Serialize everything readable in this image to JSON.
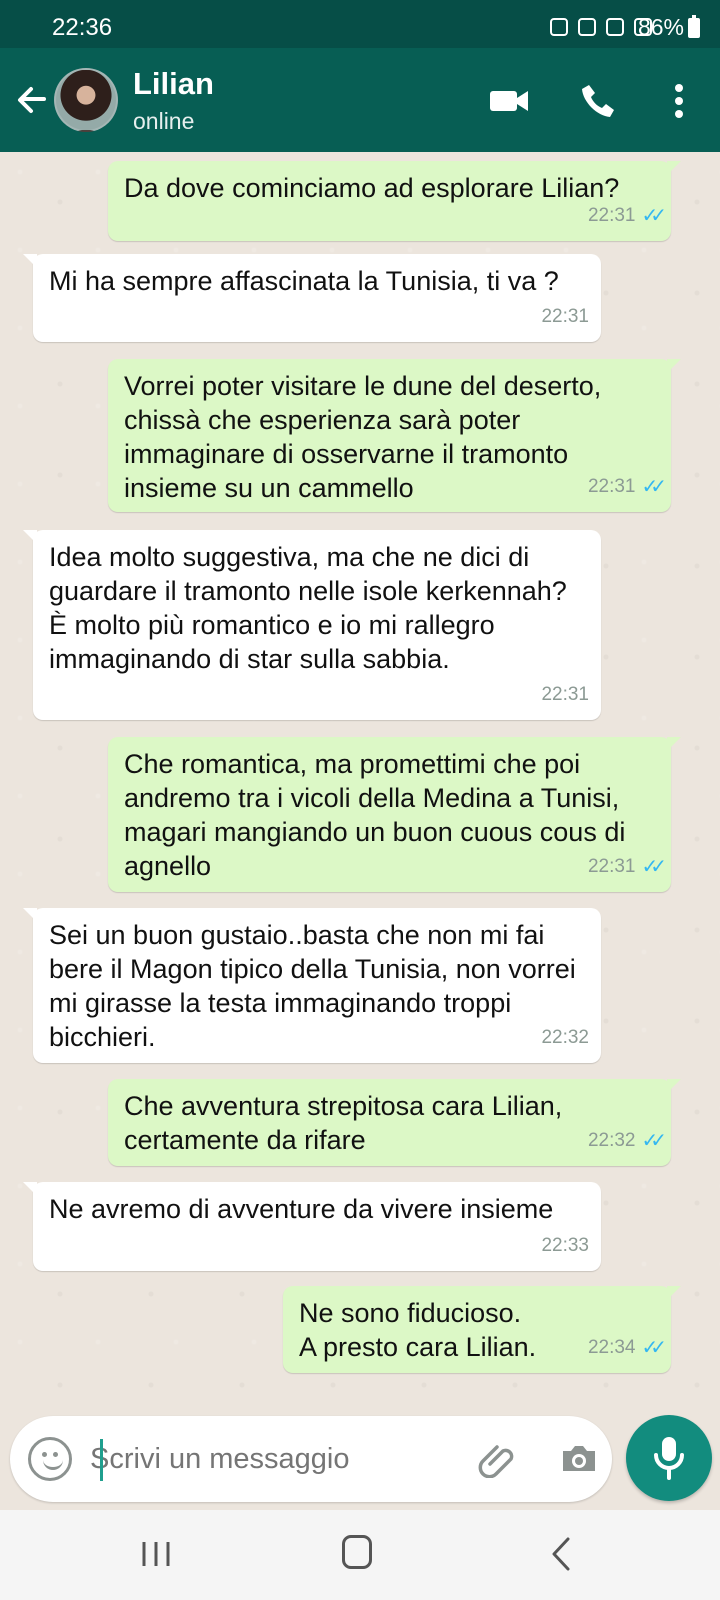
{
  "status_bar": {
    "time": "22:36",
    "battery": "86%"
  },
  "chat_header": {
    "contact_name": "Lilian",
    "status": "online",
    "icons": [
      "back-arrow-icon",
      "video-call-icon",
      "phone-icon",
      "more-options-icon"
    ]
  },
  "messages": [
    {
      "direction": "sent",
      "text": "Da dove cominciamo ad esplorare Lilian?",
      "time": "22:31",
      "read": true
    },
    {
      "direction": "received",
      "text": "Mi ha sempre affascinata la Tunisia, ti va ?",
      "time": "22:31"
    },
    {
      "direction": "sent",
      "text": "Vorrei poter visitare le dune del deserto, chissà che esperienza sarà poter immaginare di osservarne il tramonto insieme su un cammello",
      "time": "22:31",
      "read": true
    },
    {
      "direction": "received",
      "text": "Idea molto suggestiva, ma che ne dici di guardare il tramonto nelle isole kerkennah? È molto più romantico e io mi rallegro immaginando di star sulla sabbia.",
      "time": "22:31"
    },
    {
      "direction": "sent",
      "text": "Che romantica, ma promettimi che poi andremo tra i vicoli della Medina a Tunisi, magari mangiando un buon cuous cous di agnello",
      "time": "22:31",
      "read": true
    },
    {
      "direction": "received",
      "text": "Sei un buon gustaio..basta che non mi fai bere il Magon tipico della Tunisia, non vorrei mi girasse la testa immaginando troppi bicchieri.",
      "time": "22:32"
    },
    {
      "direction": "sent",
      "text": "Che avventura strepitosa cara Lilian, certamente da rifare",
      "time": "22:32",
      "read": true
    },
    {
      "direction": "received",
      "text": "Ne avremo di avventure da vivere insieme",
      "time": "22:33"
    },
    {
      "direction": "sent",
      "text": "Ne sono fiducioso.\nA presto cara Lilian.",
      "time": "22:34",
      "read": true
    }
  ],
  "composer": {
    "placeholder": "Scrivi un messaggio",
    "icons": [
      "emoji-icon",
      "attach-icon",
      "camera-icon",
      "microphone-icon"
    ]
  },
  "navbar": {
    "icons": [
      "recent-apps-icon",
      "home-icon",
      "back-icon"
    ]
  },
  "colors": {
    "header": "#075e54",
    "status_bar": "#064e47",
    "sent_bubble": "#dcf8c6",
    "received_bubble": "#ffffff",
    "read_ticks": "#34b7f1",
    "mic_button": "#128c7e"
  }
}
